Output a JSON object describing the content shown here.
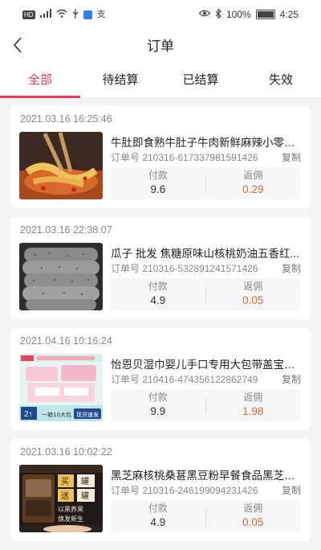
{
  "status_bar": {
    "left_badges": [
      "HD",
      "⁴⁶"
    ],
    "app_text": "支",
    "battery": "100%",
    "time": "4:25"
  },
  "header": {
    "title": "订单"
  },
  "tabs": [
    {
      "label": "全部",
      "active": true
    },
    {
      "label": "待结算",
      "active": false
    },
    {
      "label": "已结算",
      "active": false
    },
    {
      "label": "失效",
      "active": false
    }
  ],
  "labels": {
    "pay": "付款",
    "rebate": "返佣",
    "copy": "复制"
  },
  "orders": [
    {
      "time": "2021.03.16 16:25:46",
      "title": "牛肚即食熟牛肚子牛肉新鲜麻辣小零食...",
      "order_no": "订单号 210316-617337981591426",
      "pay": "9.6",
      "rebate": "0.29"
    },
    {
      "time": "2021.03.16 22:38:07",
      "title": "瓜子 批发 焦糖原味山核桃奶油五香红...",
      "order_no": "订单号 210316-532891241571426",
      "pay": "4.9",
      "rebate": "0.05"
    },
    {
      "time": "2021.04.16 10:16:24",
      "title": "怡恩贝湿巾婴儿手口专用大包带盖宝宝...",
      "order_no": "订单号 210416-474356122862749",
      "pay": "9.9",
      "rebate": "1.98",
      "image_text": [
        "2↑",
        "一箱10大包",
        "现货速发"
      ]
    },
    {
      "time": "2021.03.16 10:02:22",
      "title": "黑芝麻核桃桑葚黑豆粉早餐食品黑芝麻...",
      "order_no": "订单号 210316-246199094231426",
      "pay": "4.9",
      "rebate": "0.05",
      "image_text": [
        "买",
        "罐",
        "送",
        "罐",
        "以黑养黑",
        "焕发新生"
      ]
    }
  ],
  "colors": {
    "accent": "#f0365a",
    "rebate": "#e0692e"
  }
}
